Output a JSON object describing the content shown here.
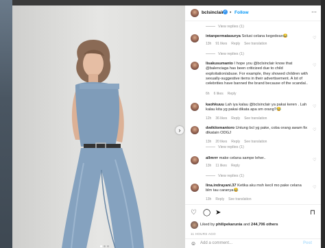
{
  "header": {
    "username": "bclsinclair",
    "separator": "•",
    "follow_label": "Follow",
    "more_icon": "more-horizontal-icon"
  },
  "view_replies_top": "View replies (1)",
  "comments": [
    {
      "user": "intanpermatasurya",
      "text": "Solusi celana kegedean😂",
      "age": "13h",
      "likes": "91 likes",
      "reply": "Reply",
      "translation": "See translation",
      "view_replies": "View replies (1)"
    },
    {
      "user": "lisakusumanto",
      "text": "I hope you @bclsinclair know that @balenciaga has been criticized due to child exploitation/abuse. For example, they showed children with sexually-suggestive items in their advertisement. A lot of celebrities have banned the brand because of the scandal..",
      "age": "6h",
      "likes": "6 likes",
      "reply": "Reply",
      "view_replies": ""
    },
    {
      "user": "kaohkuuu",
      "text": "Lah iya kalau @bclsinclair ya pakai keren . Lah kalau kita yg pakai dikata apa sm orang?😂",
      "age": "12h",
      "likes": "36 likes",
      "reply": "Reply",
      "translation": "See translation",
      "view_replies": ""
    },
    {
      "user": "dwikiiomantoro",
      "text": "Untung bcl yg pake, coba orang awam fix dikatain ODGJ",
      "age": "13h",
      "likes": "20 likes",
      "reply": "Reply",
      "translation": "See translation",
      "view_replies": "View replies (1)"
    },
    {
      "user": "allmrrr",
      "text": "make celana sampe leher..",
      "age": "13h",
      "likes": "11 likes",
      "reply": "Reply",
      "view_replies": "View replies (1)"
    },
    {
      "user": "lina.indrayani.37",
      "text": "Ketika aku msh kecil mo pake celana blm tau caranya😂",
      "age": "13h",
      "likes": "",
      "reply": "Reply",
      "translation": "See translation",
      "view_replies": ""
    }
  ],
  "actions": {
    "liked_by_prefix": "Liked by",
    "liked_by_user": "philipekarunia",
    "liked_and": "and",
    "liked_count": "244,706 others",
    "time_ago": "11 HOURS AGO"
  },
  "add_comment": {
    "placeholder": "Add a comment...",
    "post_label": "Post"
  },
  "colors": {
    "accent": "#0095f6",
    "verified": "#3897f0",
    "denim": "#7e9bb8"
  }
}
